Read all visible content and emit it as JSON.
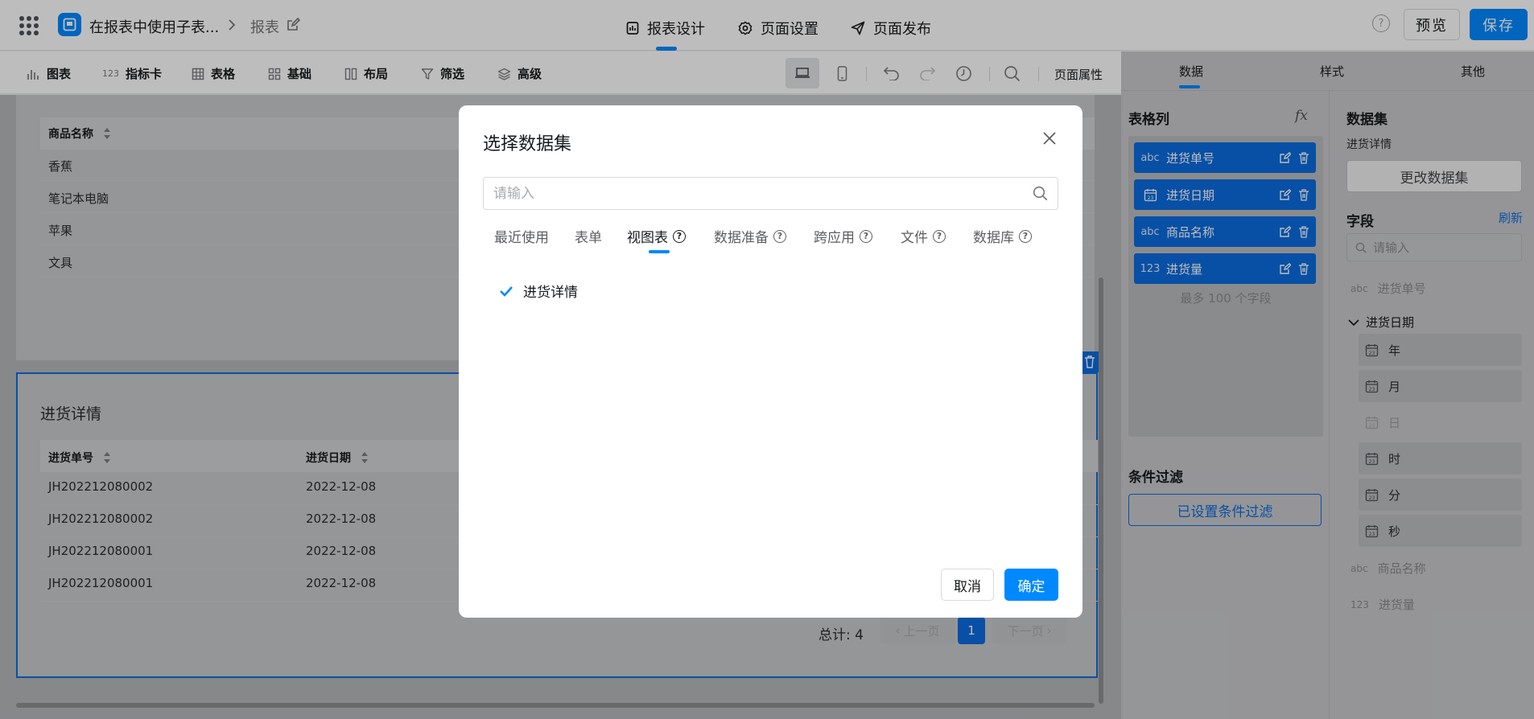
{
  "header": {
    "app_title": "在报表中使用子表...",
    "breadcrumb_current": "报表",
    "nav_tabs": [
      {
        "label": "报表设计",
        "icon": "report-design-icon",
        "active": true
      },
      {
        "label": "页面设置",
        "icon": "gear-icon",
        "active": false
      },
      {
        "label": "页面发布",
        "icon": "send-icon",
        "active": false
      }
    ],
    "help_glyph": "?",
    "preview_label": "预览",
    "save_label": "保存"
  },
  "toolbar": {
    "items": [
      {
        "label": "图表",
        "icon": "bar-chart-icon"
      },
      {
        "label": "指标卡",
        "icon": "number-card-icon",
        "icon_text": "123"
      },
      {
        "label": "表格",
        "icon": "table-icon"
      },
      {
        "label": "基础",
        "icon": "basic-widgets-icon"
      },
      {
        "label": "布局",
        "icon": "layout-icon"
      },
      {
        "label": "筛选",
        "icon": "filter-icon"
      },
      {
        "label": "高级",
        "icon": "layers-icon"
      }
    ],
    "page_props_label": "页面属性"
  },
  "canvas": {
    "table1": {
      "header": "商品名称",
      "rows": [
        "香蕉",
        "笔记本电脑",
        "苹果",
        "文具"
      ]
    },
    "table2": {
      "title": "进货详情",
      "headers": [
        "进货单号",
        "进货日期"
      ],
      "rows": [
        [
          "JH202212080002",
          "2022-12-08"
        ],
        [
          "JH202212080002",
          "2022-12-08"
        ],
        [
          "JH202212080001",
          "2022-12-08"
        ],
        [
          "JH202212080001",
          "2022-12-08"
        ]
      ]
    },
    "pagination": {
      "total_label": "总计: 4",
      "prev_label": "上一页",
      "current_page": "1",
      "next_label": "下一页"
    }
  },
  "right_panel": {
    "tabs": [
      "数据",
      "样式",
      "其他"
    ],
    "columns_title": "表格列",
    "fx_label": "fx",
    "columns": [
      {
        "prefix": "abc",
        "label": "进货单号"
      },
      {
        "prefix": "cal",
        "label": "进货日期"
      },
      {
        "prefix": "abc",
        "label": "商品名称"
      },
      {
        "prefix": "123",
        "label": "进货量"
      }
    ],
    "columns_hint": "最多 100 个字段",
    "filter_title": "条件过滤",
    "filter_button": "已设置条件过滤",
    "dataset_title": "数据集",
    "dataset_name": "进货详情",
    "change_dataset_label": "更改数据集",
    "fields_title": "字段",
    "refresh_label": "刷新",
    "field_search_placeholder": "请输入",
    "fields": {
      "f1": {
        "prefix": "abc",
        "label": "进货单号"
      },
      "group": "进货日期",
      "sub": [
        "年",
        "月",
        "日",
        "时",
        "分",
        "秒"
      ],
      "f3": {
        "prefix": "abc",
        "label": "商品名称"
      },
      "f4": {
        "prefix": "123",
        "label": "进货量"
      }
    }
  },
  "modal": {
    "title": "选择数据集",
    "search_placeholder": "请输入",
    "tabs": [
      {
        "label": "最近使用",
        "help": false
      },
      {
        "label": "表单",
        "help": false
      },
      {
        "label": "视图表",
        "help": true,
        "active": true
      },
      {
        "label": "数据准备",
        "help": true
      },
      {
        "label": "跨应用",
        "help": true
      },
      {
        "label": "文件",
        "help": true
      },
      {
        "label": "数据库",
        "help": true
      }
    ],
    "help_glyph": "?",
    "selected_item": "进货详情",
    "cancel_label": "取消",
    "ok_label": "确定"
  },
  "colors": {
    "primary": "#0089ff",
    "selection": "#0c6ddf"
  }
}
